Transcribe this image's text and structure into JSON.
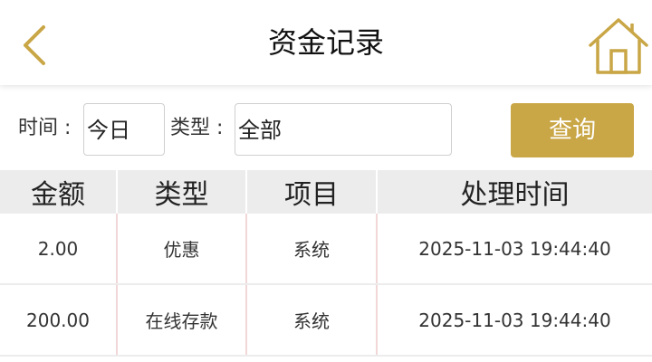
{
  "header": {
    "title": "资金记录",
    "back_icon": "chevron-left-icon",
    "home_icon": "home-icon"
  },
  "filter": {
    "time_label": "时间 :",
    "time_value": "今日",
    "type_label": "类型 :",
    "type_value": "全部",
    "query_label": "查询"
  },
  "table": {
    "headers": [
      "金额",
      "类型",
      "项目",
      "处理时间"
    ],
    "rows": [
      [
        "2.00",
        "优惠",
        "系统",
        "2025-11-03 19:44:40"
      ],
      [
        "200.00",
        "在线存款",
        "系统",
        "2025-11-03 19:44:40"
      ]
    ]
  },
  "colors": {
    "accent": "#c9a646",
    "header_bg": "#ececec",
    "row_divider": "#f1d7d7"
  }
}
